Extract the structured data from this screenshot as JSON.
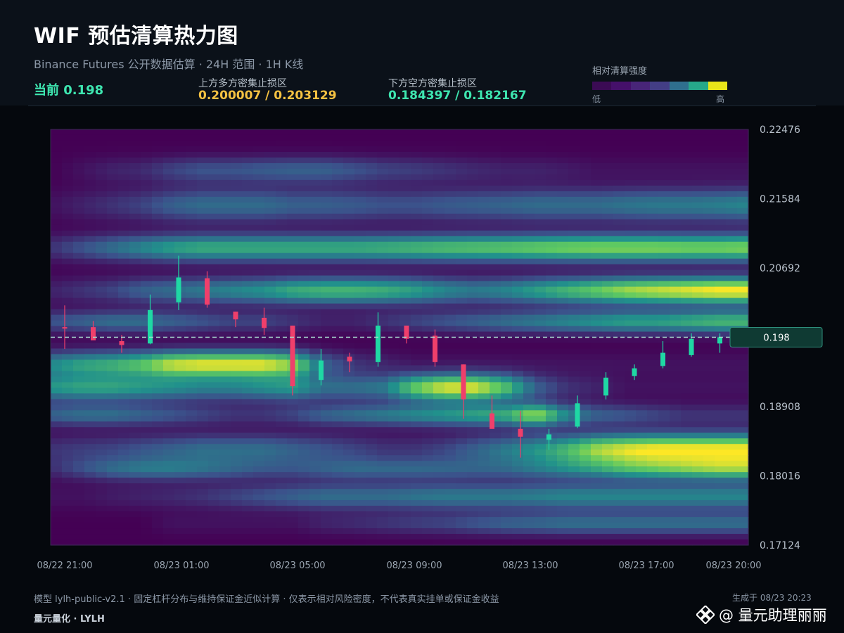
{
  "header": {
    "title": "WIF 预估清算热力图",
    "subtitle": "Binance Futures 公开数据估算 · 24H 范围 · 1H K线",
    "current": "当前 0.198",
    "upper_label": "上方多方密集止损区",
    "upper_value": "0.200007 / 0.203129",
    "lower_label": "下方空方密集止损区",
    "lower_value": "0.184397 / 0.182167",
    "legend_title": "相对清算强度",
    "legend_low": "低",
    "legend_high": "高"
  },
  "colors": {
    "up": "#1fd8a4",
    "down": "#ef3f6b",
    "current_line": "#a8dcd0",
    "upper_value": "#f5c242",
    "lower_value": "#3ee6b0",
    "legend": [
      "#3b0b54",
      "#45106a",
      "#482578",
      "#433e85",
      "#2f6f8e",
      "#26a88a",
      "#e8e519"
    ]
  },
  "footer": {
    "note": "模型 lylh-public-v2.1 · 固定杠杆分布与维持保证金近似计算 · 仅表示相对风险密度，不代表真实挂单或保证金收益",
    "brand": "量元量化 · LYLH",
    "generated": "生成于 08/23 20:23",
    "watermark": "@ 量元助理丽丽"
  },
  "chart_data": {
    "type": "heatmap",
    "title": "WIF 预估清算热力图",
    "x_ticks": [
      "08/22 21:00",
      "08/23 01:00",
      "08/23 05:00",
      "08/23 09:00",
      "08/23 13:00",
      "08/23 17:00",
      "08/23 20:00"
    ],
    "y_ticks": [
      0.22476,
      0.21584,
      0.20692,
      0.198,
      0.18908,
      0.18016,
      0.17124
    ],
    "y_tick_labels": [
      "0.22476",
      "0.21584",
      "0.20692",
      "",
      "0.18908",
      "0.18016",
      "0.17124"
    ],
    "ylim": [
      0.17124,
      0.22476
    ],
    "x_range_hours": [
      0,
      24
    ],
    "current_price": 0.198,
    "current_label": "0.198",
    "candles": [
      {
        "t": 0,
        "o": 0.1993,
        "h": 0.2021,
        "l": 0.1965,
        "c": 0.1992
      },
      {
        "t": 1,
        "o": 0.1993,
        "h": 0.2001,
        "l": 0.198,
        "c": 0.1976
      },
      {
        "t": 2,
        "o": 0.1975,
        "h": 0.1983,
        "l": 0.196,
        "c": 0.197
      },
      {
        "t": 3,
        "o": 0.1972,
        "h": 0.2035,
        "l": 0.1971,
        "c": 0.2015
      },
      {
        "t": 4,
        "o": 0.2025,
        "h": 0.2085,
        "l": 0.2015,
        "c": 0.2057
      },
      {
        "t": 5,
        "o": 0.2056,
        "h": 0.2065,
        "l": 0.2018,
        "c": 0.2022
      },
      {
        "t": 6,
        "o": 0.2013,
        "h": 0.2013,
        "l": 0.1993,
        "c": 0.2003
      },
      {
        "t": 7,
        "o": 0.2005,
        "h": 0.2018,
        "l": 0.1983,
        "c": 0.1992
      },
      {
        "t": 8,
        "o": 0.1995,
        "h": 0.1995,
        "l": 0.1905,
        "c": 0.1917
      },
      {
        "t": 9,
        "o": 0.1925,
        "h": 0.1965,
        "l": 0.1918,
        "c": 0.195
      },
      {
        "t": 10,
        "o": 0.1955,
        "h": 0.196,
        "l": 0.1935,
        "c": 0.1949
      },
      {
        "t": 11,
        "o": 0.1948,
        "h": 0.2012,
        "l": 0.1942,
        "c": 0.1995
      },
      {
        "t": 12,
        "o": 0.1995,
        "h": 0.1995,
        "l": 0.1972,
        "c": 0.1978
      },
      {
        "t": 13,
        "o": 0.1982,
        "h": 0.199,
        "l": 0.1942,
        "c": 0.1948
      },
      {
        "t": 14,
        "o": 0.1945,
        "h": 0.1945,
        "l": 0.1875,
        "c": 0.19
      },
      {
        "t": 15,
        "o": 0.1882,
        "h": 0.1905,
        "l": 0.1865,
        "c": 0.1862
      },
      {
        "t": 16,
        "o": 0.1862,
        "h": 0.1885,
        "l": 0.1825,
        "c": 0.1852
      },
      {
        "t": 17,
        "o": 0.1848,
        "h": 0.1862,
        "l": 0.1835,
        "c": 0.1855
      },
      {
        "t": 18,
        "o": 0.1865,
        "h": 0.1905,
        "l": 0.1863,
        "c": 0.1895
      },
      {
        "t": 19,
        "o": 0.1905,
        "h": 0.1935,
        "l": 0.19,
        "c": 0.1928
      },
      {
        "t": 20,
        "o": 0.193,
        "h": 0.1945,
        "l": 0.1925,
        "c": 0.194
      },
      {
        "t": 21,
        "o": 0.1943,
        "h": 0.1975,
        "l": 0.194,
        "c": 0.196
      },
      {
        "t": 22,
        "o": 0.1957,
        "h": 0.1985,
        "l": 0.1955,
        "c": 0.1978
      },
      {
        "t": 23,
        "o": 0.1972,
        "h": 0.1985,
        "l": 0.196,
        "c": 0.198
      }
    ],
    "liquidation_bands": [
      {
        "price": 0.2095,
        "width": 0.0012,
        "intensity": [
          0.15,
          0.25,
          0.35,
          0.45,
          0.55,
          0.6,
          0.6,
          0.6,
          0.6,
          0.6,
          0.6,
          0.62,
          0.65,
          0.68,
          0.7,
          0.72,
          0.75,
          0.78,
          0.8,
          0.8,
          0.8,
          0.78,
          0.78,
          0.8
        ]
      },
      {
        "price": 0.204,
        "width": 0.0012,
        "intensity": [
          0.1,
          0.15,
          0.2,
          0.3,
          0.35,
          0.4,
          0.45,
          0.5,
          0.6,
          0.65,
          0.65,
          0.62,
          0.55,
          0.45,
          0.4,
          0.45,
          0.55,
          0.65,
          0.75,
          0.85,
          0.9,
          0.95,
          1.0,
          1.0
        ]
      },
      {
        "price": 0.2,
        "width": 0.001,
        "intensity": [
          0.25,
          0.3,
          0.35,
          0.35,
          0.3,
          0.25,
          0.2,
          0.2,
          0.15,
          0.1,
          0.1,
          0.15,
          0.2,
          0.25,
          0.3,
          0.35,
          0.4,
          0.45,
          0.5,
          0.55,
          0.55,
          0.6,
          0.65,
          0.65
        ]
      },
      {
        "price": 0.215,
        "width": 0.0015,
        "intensity": [
          0.05,
          0.1,
          0.15,
          0.2,
          0.3,
          0.35,
          0.35,
          0.35,
          0.3,
          0.3,
          0.28,
          0.25,
          0.25,
          0.28,
          0.3,
          0.32,
          0.35,
          0.35,
          0.35,
          0.38,
          0.4,
          0.4,
          0.42,
          0.45
        ]
      },
      {
        "price": 0.2195,
        "width": 0.0012,
        "intensity": [
          0.0,
          0.05,
          0.1,
          0.12,
          0.2,
          0.25,
          0.25,
          0.28,
          0.3,
          0.3,
          0.25,
          0.2,
          0.18,
          0.15,
          0.12,
          0.1,
          0.1,
          0.08,
          0.05,
          0.05,
          0.05,
          0.05,
          0.05,
          0.05
        ]
      },
      {
        "price": 0.1945,
        "width": 0.0012,
        "intensity": [
          0.45,
          0.55,
          0.6,
          0.7,
          0.9,
          0.95,
          0.95,
          0.95,
          0.8,
          0.3,
          0.15,
          0.1,
          0.05,
          0.05,
          0.05,
          0.05,
          0.05,
          0.05,
          0.05,
          0.05,
          0.05,
          0.05,
          0.05,
          0.05
        ]
      },
      {
        "price": 0.1915,
        "width": 0.0012,
        "intensity": [
          0.5,
          0.55,
          0.55,
          0.5,
          0.45,
          0.4,
          0.4,
          0.45,
          0.5,
          0.35,
          0.35,
          0.4,
          0.75,
          0.95,
          0.95,
          0.7,
          0.3,
          0.15,
          0.1,
          0.05,
          0.05,
          0.05,
          0.05,
          0.05
        ]
      },
      {
        "price": 0.188,
        "width": 0.001,
        "intensity": [
          0.3,
          0.35,
          0.35,
          0.3,
          0.25,
          0.2,
          0.15,
          0.15,
          0.2,
          0.3,
          0.35,
          0.4,
          0.45,
          0.5,
          0.55,
          0.6,
          0.85,
          0.45,
          0.3,
          0.25,
          0.2,
          0.15,
          0.15,
          0.15
        ]
      },
      {
        "price": 0.1835,
        "width": 0.0014,
        "intensity": [
          0.15,
          0.18,
          0.2,
          0.25,
          0.3,
          0.35,
          0.35,
          0.35,
          0.3,
          0.25,
          0.2,
          0.15,
          0.15,
          0.2,
          0.3,
          0.4,
          0.5,
          0.65,
          0.85,
          0.95,
          1.0,
          1.0,
          1.0,
          1.0
        ]
      },
      {
        "price": 0.181,
        "width": 0.001,
        "intensity": [
          0.1,
          0.2,
          0.3,
          0.35,
          0.35,
          0.3,
          0.25,
          0.2,
          0.2,
          0.25,
          0.3,
          0.3,
          0.3,
          0.28,
          0.25,
          0.25,
          0.3,
          0.35,
          0.4,
          0.5,
          0.55,
          0.6,
          0.65,
          0.65
        ]
      },
      {
        "price": 0.1775,
        "width": 0.0012,
        "intensity": [
          0.05,
          0.05,
          0.08,
          0.1,
          0.12,
          0.15,
          0.2,
          0.25,
          0.3,
          0.35,
          0.35,
          0.35,
          0.38,
          0.4,
          0.4,
          0.4,
          0.42,
          0.45,
          0.45,
          0.45,
          0.45,
          0.45,
          0.45,
          0.45
        ]
      },
      {
        "price": 0.174,
        "width": 0.001,
        "intensity": [
          0.0,
          0.0,
          0.0,
          0.0,
          0.05,
          0.05,
          0.05,
          0.05,
          0.05,
          0.1,
          0.12,
          0.15,
          0.18,
          0.2,
          0.25,
          0.3,
          0.32,
          0.35,
          0.35,
          0.35,
          0.35,
          0.35,
          0.35,
          0.35
        ]
      }
    ]
  }
}
